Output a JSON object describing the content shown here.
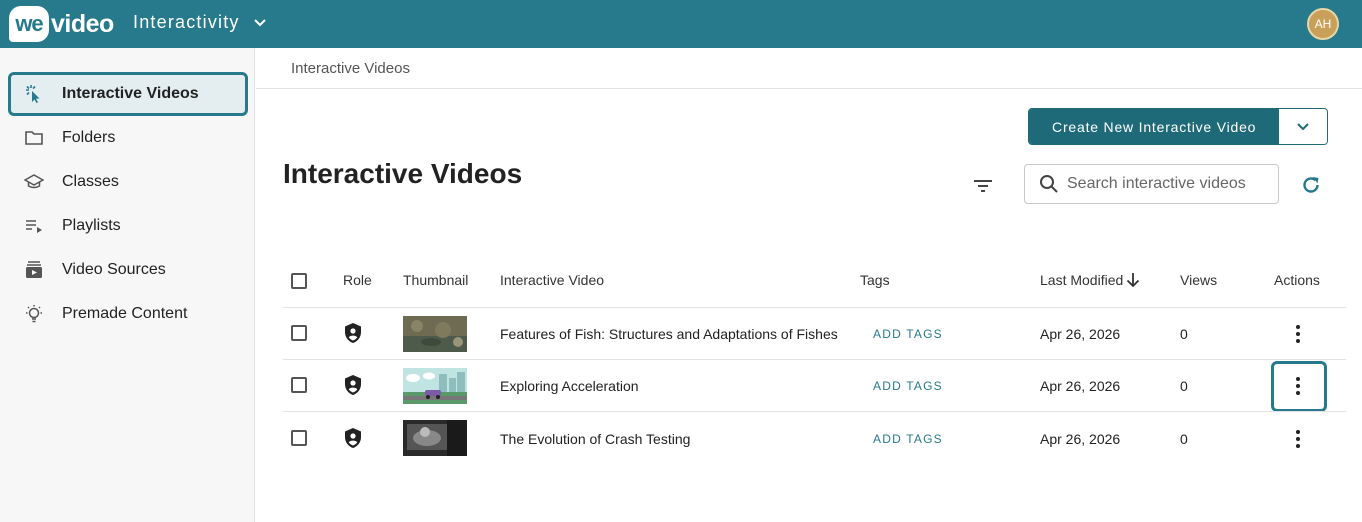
{
  "topbar": {
    "logo_we": "we",
    "logo_video": "video",
    "app_name": "Interactivity",
    "avatar_initials": "AH",
    "color": "#277a8c"
  },
  "sidebar": {
    "items": [
      {
        "label": "Interactive Videos",
        "icon": "cursor-click-icon",
        "active": true
      },
      {
        "label": "Folders",
        "icon": "folder-icon",
        "active": false
      },
      {
        "label": "Classes",
        "icon": "graduation-cap-icon",
        "active": false
      },
      {
        "label": "Playlists",
        "icon": "playlist-icon",
        "active": false
      },
      {
        "label": "Video Sources",
        "icon": "video-library-icon",
        "active": false
      },
      {
        "label": "Premade Content",
        "icon": "lightbulb-icon",
        "active": false
      }
    ]
  },
  "breadcrumb": "Interactive Videos",
  "main": {
    "title": "Interactive Videos",
    "create_button": "Create New Interactive Video",
    "search_placeholder": "Search interactive videos"
  },
  "table": {
    "headers": {
      "role": "Role",
      "thumbnail": "Thumbnail",
      "video": "Interactive Video",
      "tags": "Tags",
      "modified": "Last Modified",
      "views": "Views",
      "actions": "Actions"
    },
    "rows": [
      {
        "title": "Features of Fish: Structures and Adaptations of Fishes",
        "tags": "ADD TAGS",
        "modified": "Apr 26, 2026",
        "views": "0"
      },
      {
        "title": "Exploring Acceleration",
        "tags": "ADD TAGS",
        "modified": "Apr 26, 2026",
        "views": "0"
      },
      {
        "title": "The Evolution of Crash Testing",
        "tags": "ADD TAGS",
        "modified": "Apr 26, 2026",
        "views": "0"
      }
    ]
  }
}
